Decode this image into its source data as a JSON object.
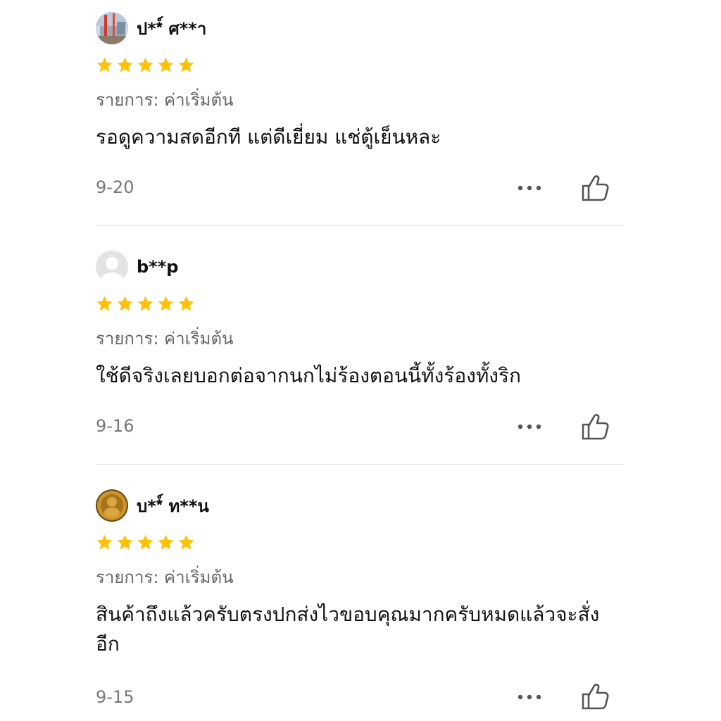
{
  "variation_prefix": "รายการ: ค่าเริ่มต้น",
  "star_color": "#FFC107",
  "reviews": [
    {
      "username": "ป**์ ศ**า",
      "rating": 5,
      "comment": "รอดูความสดอีกที แต่ดีเยี่ยม แช่ตู้เย็นหละ",
      "date": "9-20",
      "avatar": "profile-photo"
    },
    {
      "username": "b**p",
      "rating": 5,
      "comment": "ใช้ดีจริงเลยบอกต่อจากนกไม่ร้องตอนนี้ทั้งร้องทั้งริก",
      "date": "9-16",
      "avatar": "default-user-icon"
    },
    {
      "username": "บ**์ ท**น",
      "rating": 5,
      "comment": "สินค้าถึงแล้วครับตรงปกส่งไวขอบคุณมากครับหมดแล้วจะสั่งอีก",
      "date": "9-15",
      "avatar": "amulet-photo"
    }
  ]
}
